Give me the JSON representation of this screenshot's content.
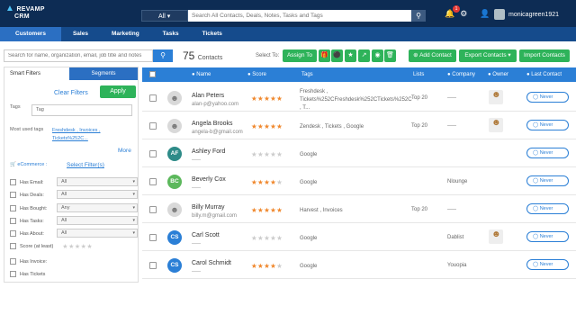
{
  "brand": {
    "name_line1": "REVAMP",
    "name_line2": "CRM"
  },
  "search": {
    "scope": "All",
    "placeholder": "Search All Contacts, Deals, Notes, Tasks and Tags"
  },
  "notifications": {
    "count": "1"
  },
  "user": {
    "name": "monicagreen1921"
  },
  "nav": [
    "Customers",
    "Sales",
    "Marketing",
    "Tasks",
    "Tickets"
  ],
  "toolbar": {
    "search_placeholder": "Search for name, organization, email, job title and notes",
    "count": "75",
    "count_label": "Contacts",
    "select_to": "Select To:",
    "assign_to": "Assign To",
    "add_contact": "Add Contact",
    "export_contacts": "Export Contacts",
    "import_contacts": "Import Contacts"
  },
  "sidebar": {
    "tab_filters": "Smart Filters",
    "tab_segments": "Segments",
    "clear_filters": "Clear Filters",
    "apply": "Apply",
    "tags_label": "Tags",
    "tags_value": "Tag",
    "most_used_label": "Most used tags",
    "most_used_line1": "Freshdesk , Invoices ,",
    "most_used_line2": "Tickets%252C...",
    "more": "More",
    "ecommerce": "eCommerce :",
    "select_filters": "Select Filter(s)",
    "filters": [
      {
        "label": "Has Email:",
        "value": "All"
      },
      {
        "label": "Has Deals:",
        "value": "All"
      },
      {
        "label": "Has Bought:",
        "value": "Any"
      },
      {
        "label": "Has Tasks:",
        "value": "All"
      },
      {
        "label": "Has About:",
        "value": "All"
      }
    ],
    "score_label": "Score (at least)",
    "extra": [
      "Has Invoice:",
      "Has Tickets"
    ]
  },
  "table": {
    "headers": {
      "name": "Name",
      "score": "Score",
      "tags": "Tags",
      "lists": "Lists",
      "company": "Company",
      "owner": "Owner",
      "last_contact": "Last Contact"
    },
    "rows": [
      {
        "name": "Alan Peters",
        "email": "alan-p@yahoo.com",
        "avatar_type": "photo",
        "initials": "",
        "avatar_color": "#d9d9d9",
        "stars": 5,
        "tags": "Freshdesk , Tickets%252CFreshdesk%252CTickets%252C , T...",
        "lists": "Top 20",
        "company": "-----",
        "has_owner": true,
        "last_contact": "Never"
      },
      {
        "name": "Angela Brooks",
        "email": "angela-b@gmail.com",
        "avatar_type": "photo",
        "initials": "",
        "avatar_color": "#d9d9d9",
        "stars": 5,
        "tags": "Zendesk , Tickets , Google",
        "lists": "Top 20",
        "company": "-----",
        "has_owner": true,
        "last_contact": "Never"
      },
      {
        "name": "Ashley Ford",
        "email": "-----",
        "avatar_type": "initials",
        "initials": "AF",
        "avatar_color": "#2e8b88",
        "stars": 0,
        "tags": "Google",
        "lists": "",
        "company": "",
        "has_owner": false,
        "last_contact": "Never"
      },
      {
        "name": "Beverly Cox",
        "email": "-----",
        "avatar_type": "initials",
        "initials": "BC",
        "avatar_color": "#5cb85c",
        "stars": 4,
        "tags": "Google",
        "lists": "",
        "company": "Nlounge",
        "has_owner": false,
        "last_contact": "Never"
      },
      {
        "name": "Billy Murray",
        "email": "billy.m@gmail.com",
        "avatar_type": "photo",
        "initials": "",
        "avatar_color": "#d9d9d9",
        "stars": 5,
        "tags": "Harvest , Invoices",
        "lists": "Top 20",
        "company": "-----",
        "has_owner": false,
        "last_contact": "Never"
      },
      {
        "name": "Carl Scott",
        "email": "-----",
        "avatar_type": "initials",
        "initials": "CS",
        "avatar_color": "#2b7fd6",
        "stars": 0,
        "tags": "Google",
        "lists": "",
        "company": "Dablist",
        "has_owner": true,
        "last_contact": "Never"
      },
      {
        "name": "Carol Schmidt",
        "email": "-----",
        "avatar_type": "initials",
        "initials": "CS",
        "avatar_color": "#2b7fd6",
        "stars": 4,
        "tags": "Google",
        "lists": "",
        "company": "Youopia",
        "has_owner": false,
        "last_contact": "Never"
      }
    ]
  }
}
